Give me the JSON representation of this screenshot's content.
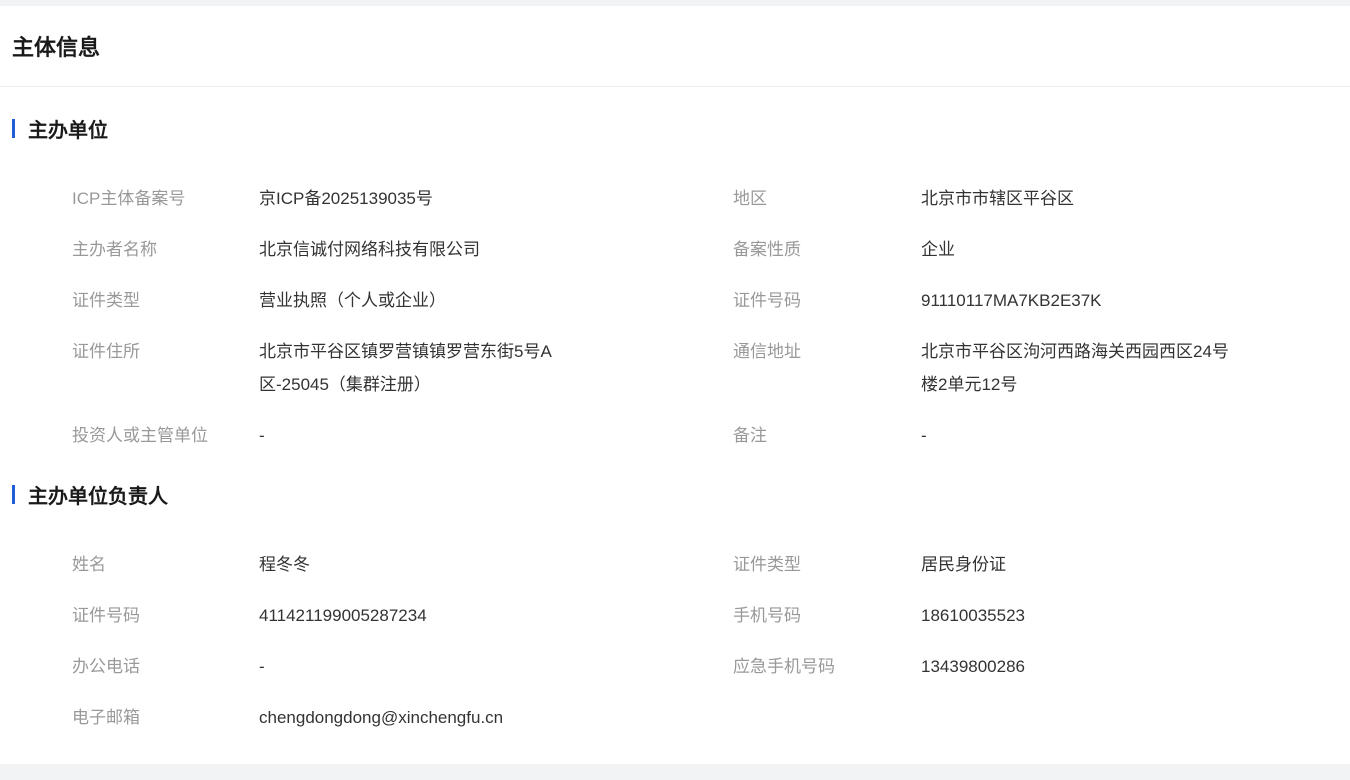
{
  "page": {
    "title": "主体信息"
  },
  "sponsor": {
    "title": "主办单位",
    "fields": [
      {
        "label": "ICP主体备案号",
        "value": "京ICP备2025139035号"
      },
      {
        "label": "地区",
        "value": "北京市市辖区平谷区"
      },
      {
        "label": "主办者名称",
        "value": "北京信诚付网络科技有限公司"
      },
      {
        "label": "备案性质",
        "value": "企业"
      },
      {
        "label": "证件类型",
        "value": "营业执照（个人或企业）"
      },
      {
        "label": "证件号码",
        "value": "91110117MA7KB2E37K"
      },
      {
        "label": "证件住所",
        "value": "北京市平谷区镇罗营镇镇罗营东街5号A区-25045（集群注册）"
      },
      {
        "label": "通信地址",
        "value": "北京市平谷区泃河西路海关西园西区24号楼2单元12号"
      },
      {
        "label": "投资人或主管单位",
        "value": "-"
      },
      {
        "label": "备注",
        "value": "-"
      }
    ]
  },
  "principal": {
    "title": "主办单位负责人",
    "fields": [
      {
        "label": "姓名",
        "value": "程冬冬"
      },
      {
        "label": "证件类型",
        "value": "居民身份证"
      },
      {
        "label": "证件号码",
        "value": "411421199005287234"
      },
      {
        "label": "手机号码",
        "value": "18610035523"
      },
      {
        "label": "办公电话",
        "value": "-"
      },
      {
        "label": "应急手机号码",
        "value": "13439800286"
      },
      {
        "label": "电子邮箱",
        "value": "chengdongdong@xinchengfu.cn"
      }
    ]
  },
  "colors": {
    "accent": "#1f5fd8",
    "label": "#999999",
    "value": "#333333",
    "background": "#f2f3f5"
  }
}
